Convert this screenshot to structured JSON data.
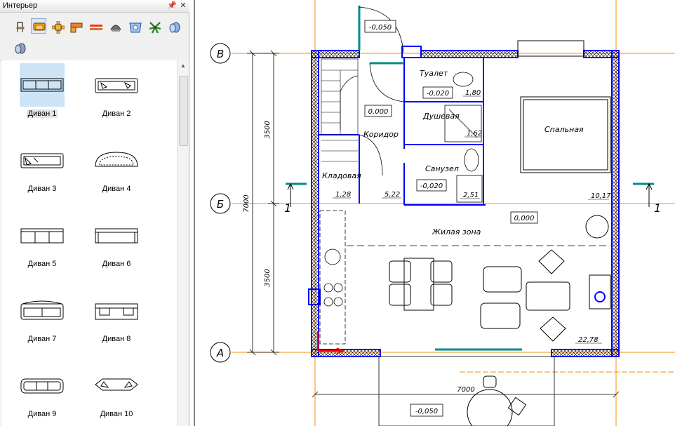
{
  "panel": {
    "title": "Интерьер",
    "pin_icon": "pin-icon",
    "close_icon": "close-icon",
    "categories": [
      {
        "name": "chair"
      },
      {
        "name": "sofa"
      },
      {
        "name": "table-set"
      },
      {
        "name": "kitchen"
      },
      {
        "name": "shelf"
      },
      {
        "name": "lamp"
      },
      {
        "name": "bathroom"
      },
      {
        "name": "plant"
      },
      {
        "name": "misc"
      }
    ],
    "items": [
      {
        "label": "Диван 1",
        "selected": true
      },
      {
        "label": "Диван 2"
      },
      {
        "label": "Диван 3"
      },
      {
        "label": "Диван 4"
      },
      {
        "label": "Диван 5"
      },
      {
        "label": "Диван 6"
      },
      {
        "label": "Диван 7"
      },
      {
        "label": "Диван 8"
      },
      {
        "label": "Диван 9"
      },
      {
        "label": "Диван 10"
      }
    ]
  },
  "plan": {
    "axes": {
      "v": "В",
      "b": "Б",
      "a": "А"
    },
    "dims": {
      "d3500_top": "3500",
      "d7000": "7000",
      "d3500_bottom": "3500",
      "d7000_bottom": "7000"
    },
    "levels": {
      "entry": "-0,050",
      "wc": "-0,020",
      "corridor": "0,000",
      "bath": "-0,020",
      "living": "0,000",
      "porch": "-0,050"
    },
    "rooms": {
      "toilet": "Туалет",
      "shower": "Душевая",
      "bathroom": "Санузел",
      "corridor": "Коридор",
      "storage": "Кладовая",
      "bedroom": "Спальная",
      "living": "Жилая зона"
    },
    "areas": {
      "toilet": "1,80",
      "shower": "1,62",
      "bathroom": "2,51",
      "storage": "1,28",
      "corridor": "5,22",
      "bedroom": "10,17",
      "living": "22,78"
    },
    "section_mark": "1"
  },
  "colors": {
    "wall": "#0000ff",
    "axis": "#ff8c00",
    "teal": "#008b8b",
    "red": "#ff0000"
  }
}
